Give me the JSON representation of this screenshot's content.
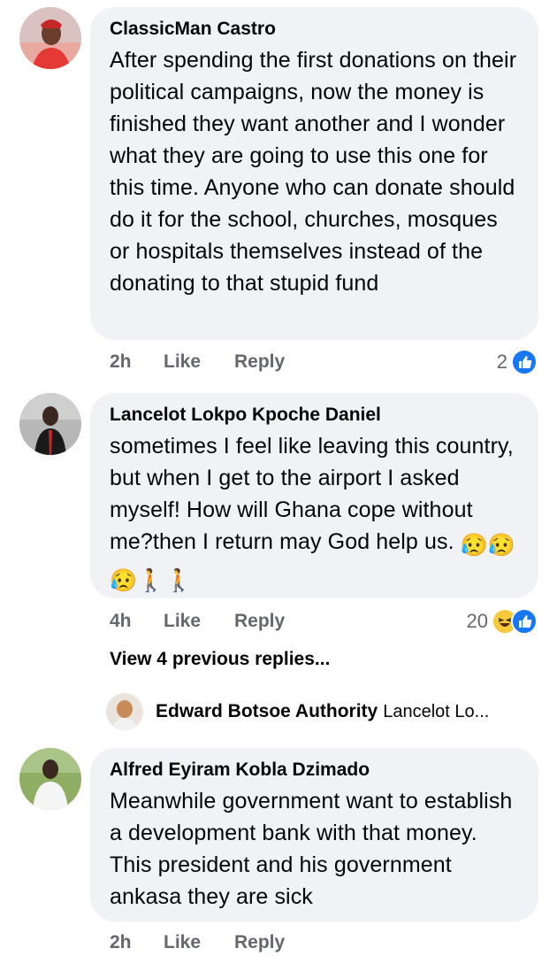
{
  "comments": [
    {
      "author": "ClassicMan Castro",
      "text": "After spending the first donations on their political campaigns, now the money is finished they want another and I wonder what they are going to use this one for this time. Anyone who can donate should do it for the school, churches, mosques or hospitals themselves instead of the donating to that stupid fund",
      "time": "2h",
      "like_label": "Like",
      "reply_label": "Reply",
      "reaction_count": "2",
      "reaction_icons": [
        "like-icon"
      ]
    },
    {
      "author": "Lancelot Lokpo Kpoche Daniel",
      "text": "sometimes I feel like leaving this country, but when I get to the airport I asked myself! How will Ghana cope without me?then I return may God help us.",
      "emojis": [
        "😥",
        "😥",
        "😥",
        "🚶",
        "🚶"
      ],
      "time": "4h",
      "like_label": "Like",
      "reply_label": "Reply",
      "reaction_count": "20",
      "reaction_icons": [
        "haha-icon",
        "like-icon"
      ]
    },
    {
      "author": "Alfred Eyiram Kobla Dzimado",
      "text": "Meanwhile government want to establish a development bank with that money. This president and his government ankasa they are sick",
      "time": "2h",
      "like_label": "Like",
      "reply_label": "Reply"
    }
  ],
  "view_replies": "View 4 previous replies...",
  "reply_preview": {
    "author": "Edward Botsoe Authority",
    "text": "Lancelot Lo..."
  },
  "colors": {
    "bubble": "#f0f2f5",
    "muted": "#65676b",
    "like_blue": "#1877f2",
    "haha_yellow": "#f7c93b"
  }
}
